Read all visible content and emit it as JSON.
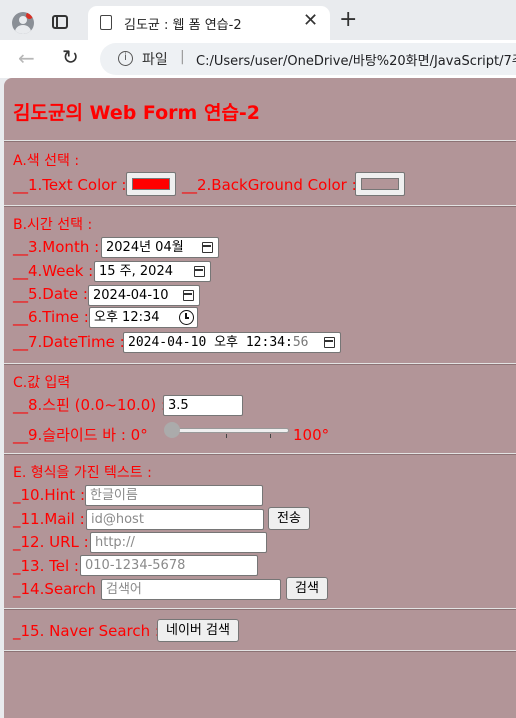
{
  "browser": {
    "tab_title": "김도균 : 웹 폼 연습-2",
    "scheme_label": "파일",
    "url": "C:/Users/user/OneDrive/바탕%20화면/JavaScript/7주"
  },
  "page": {
    "title": "김도균의 Web Form 연습-2",
    "section_a": "A.색 선택 :",
    "text_color_label": "__1.Text Color :",
    "text_color_value": "#ff0000",
    "bg_color_label": "__2.BackGround Color :",
    "bg_color_value": "#b29598",
    "section_b": "B.시간 선택 :",
    "month_label": "__3.Month :",
    "month_value": "2024년 04월",
    "week_label": "__4.Week :",
    "week_value": "15 주, 2024",
    "date_label": "__5.Date :",
    "date_value": "2024-04-10",
    "time_label": "__6.Time :",
    "time_value": "오후 12:34",
    "datetime_label": "__7.DateTime :",
    "datetime_value": "2024-04-10 오후 12:34:",
    "datetime_seconds": "56",
    "section_c": "C.값 입력",
    "spin_label": "__8.스핀 (0.0~10.0) :",
    "spin_value": "3.5",
    "slider_label": "__9.슬라이드 바 : 0°",
    "slider_max": "100°",
    "slider_value_fraction": 0,
    "section_e": "E. 형식을 가진 텍스트 :",
    "hint_label": "_10.Hint :",
    "hint_placeholder": "한글이름",
    "mail_label": "_11.Mail :",
    "mail_placeholder": "id@host",
    "mail_button": "전송",
    "url_label": "_12. URL :",
    "url_placeholder": "http://",
    "tel_label": "_13. Tel :",
    "tel_placeholder": "010-1234-5678",
    "search_label": "_14.Search :",
    "search_placeholder": "검색어",
    "search_button": "검색",
    "naver_label": "_15. Naver Search :",
    "naver_button": "네이버 검색"
  },
  "icons": {
    "profile": "profile-avatar-icon",
    "tabs": "tab-actions-icon",
    "doc": "document-icon",
    "close": "close-icon",
    "new_tab": "plus-icon",
    "back": "arrow-left-icon",
    "reload": "reload-icon",
    "info": "info-icon",
    "calendar": "calendar-icon",
    "clock": "clock-icon"
  }
}
